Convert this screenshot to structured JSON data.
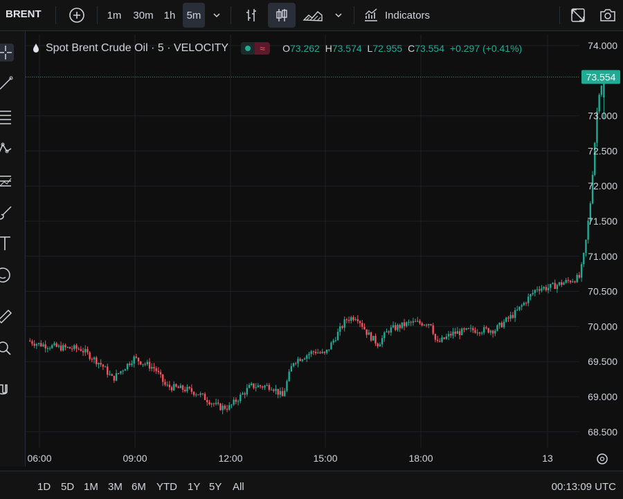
{
  "toolbar": {
    "symbol": "BRENT",
    "intervals": [
      "1m",
      "30m",
      "1h",
      "5m"
    ],
    "active_interval": "5m",
    "indicators_label": "Indicators"
  },
  "legend": {
    "title": "Spot Brent Crude Oil · 5 · VELOCITY",
    "o_label": "O",
    "o_value": "73.262",
    "h_label": "H",
    "h_value": "73.574",
    "l_label": "L",
    "l_value": "72.955",
    "c_label": "C",
    "c_value": "73.554",
    "change": "+0.297 (+0.41%)"
  },
  "price_axis": {
    "ticks": [
      "74.000",
      "73.000",
      "72.500",
      "72.000",
      "71.500",
      "71.000",
      "70.500",
      "70.000",
      "69.500",
      "69.000",
      "68.500"
    ],
    "last_price": "73.554"
  },
  "time_axis": {
    "ticks": [
      "06:00",
      "09:00",
      "12:00",
      "15:00",
      "18:00",
      "13"
    ]
  },
  "ranges": [
    "1D",
    "5D",
    "1M",
    "3M",
    "6M",
    "YTD",
    "1Y",
    "5Y",
    "All"
  ],
  "clock": "00:13:09 UTC",
  "colors": {
    "up": "#22ab94",
    "down": "#f7525f",
    "background": "#0f0f0f",
    "grid": "#1e2126"
  },
  "chart_data": {
    "type": "candlestick",
    "title": "Spot Brent Crude Oil · 5 · VELOCITY",
    "ylim": [
      68.3,
      74.2
    ],
    "y_ticks": [
      68.5,
      69.0,
      69.5,
      70.0,
      70.5,
      71.0,
      71.5,
      72.0,
      72.5,
      73.0,
      74.0
    ],
    "x_ticks": [
      "06:00",
      "09:00",
      "12:00",
      "15:00",
      "18:00",
      "13"
    ],
    "price_path": [
      {
        "t": "05:40",
        "p": 69.8
      },
      {
        "t": "06:00",
        "p": 69.75
      },
      {
        "t": "06:40",
        "p": 69.7
      },
      {
        "t": "07:20",
        "p": 69.68
      },
      {
        "t": "08:00",
        "p": 69.45
      },
      {
        "t": "08:20",
        "p": 69.25
      },
      {
        "t": "09:00",
        "p": 69.55
      },
      {
        "t": "09:40",
        "p": 69.4
      },
      {
        "t": "10:00",
        "p": 69.15
      },
      {
        "t": "10:40",
        "p": 69.1
      },
      {
        "t": "11:00",
        "p": 69.05
      },
      {
        "t": "11:40",
        "p": 68.85
      },
      {
        "t": "12:00",
        "p": 68.85
      },
      {
        "t": "12:40",
        "p": 69.15
      },
      {
        "t": "13:20",
        "p": 69.15
      },
      {
        "t": "13:40",
        "p": 69.0
      },
      {
        "t": "14:00",
        "p": 69.5
      },
      {
        "t": "14:40",
        "p": 69.65
      },
      {
        "t": "15:00",
        "p": 69.6
      },
      {
        "t": "15:40",
        "p": 70.1
      },
      {
        "t": "16:00",
        "p": 70.15
      },
      {
        "t": "16:20",
        "p": 69.9
      },
      {
        "t": "16:40",
        "p": 69.75
      },
      {
        "t": "17:00",
        "p": 69.95
      },
      {
        "t": "17:40",
        "p": 70.05
      },
      {
        "t": "18:20",
        "p": 70.05
      },
      {
        "t": "18:30",
        "p": 69.75
      },
      {
        "t": "19:00",
        "p": 69.9
      },
      {
        "t": "19:40",
        "p": 69.95
      },
      {
        "t": "20:20",
        "p": 69.95
      },
      {
        "t": "21:00",
        "p": 70.2
      },
      {
        "t": "21:40",
        "p": 70.55
      },
      {
        "t": "22:00",
        "p": 70.55
      },
      {
        "t": "22:20",
        "p": 70.6
      },
      {
        "t": "23:00",
        "p": 70.7
      },
      {
        "t": "23:10",
        "p": 71.1
      },
      {
        "t": "23:20",
        "p": 71.75
      },
      {
        "t": "23:35",
        "p": 73.3
      },
      {
        "t": "23:45",
        "p": 73.554
      }
    ],
    "last": {
      "open": 73.262,
      "high": 73.574,
      "low": 72.955,
      "close": 73.554
    }
  }
}
